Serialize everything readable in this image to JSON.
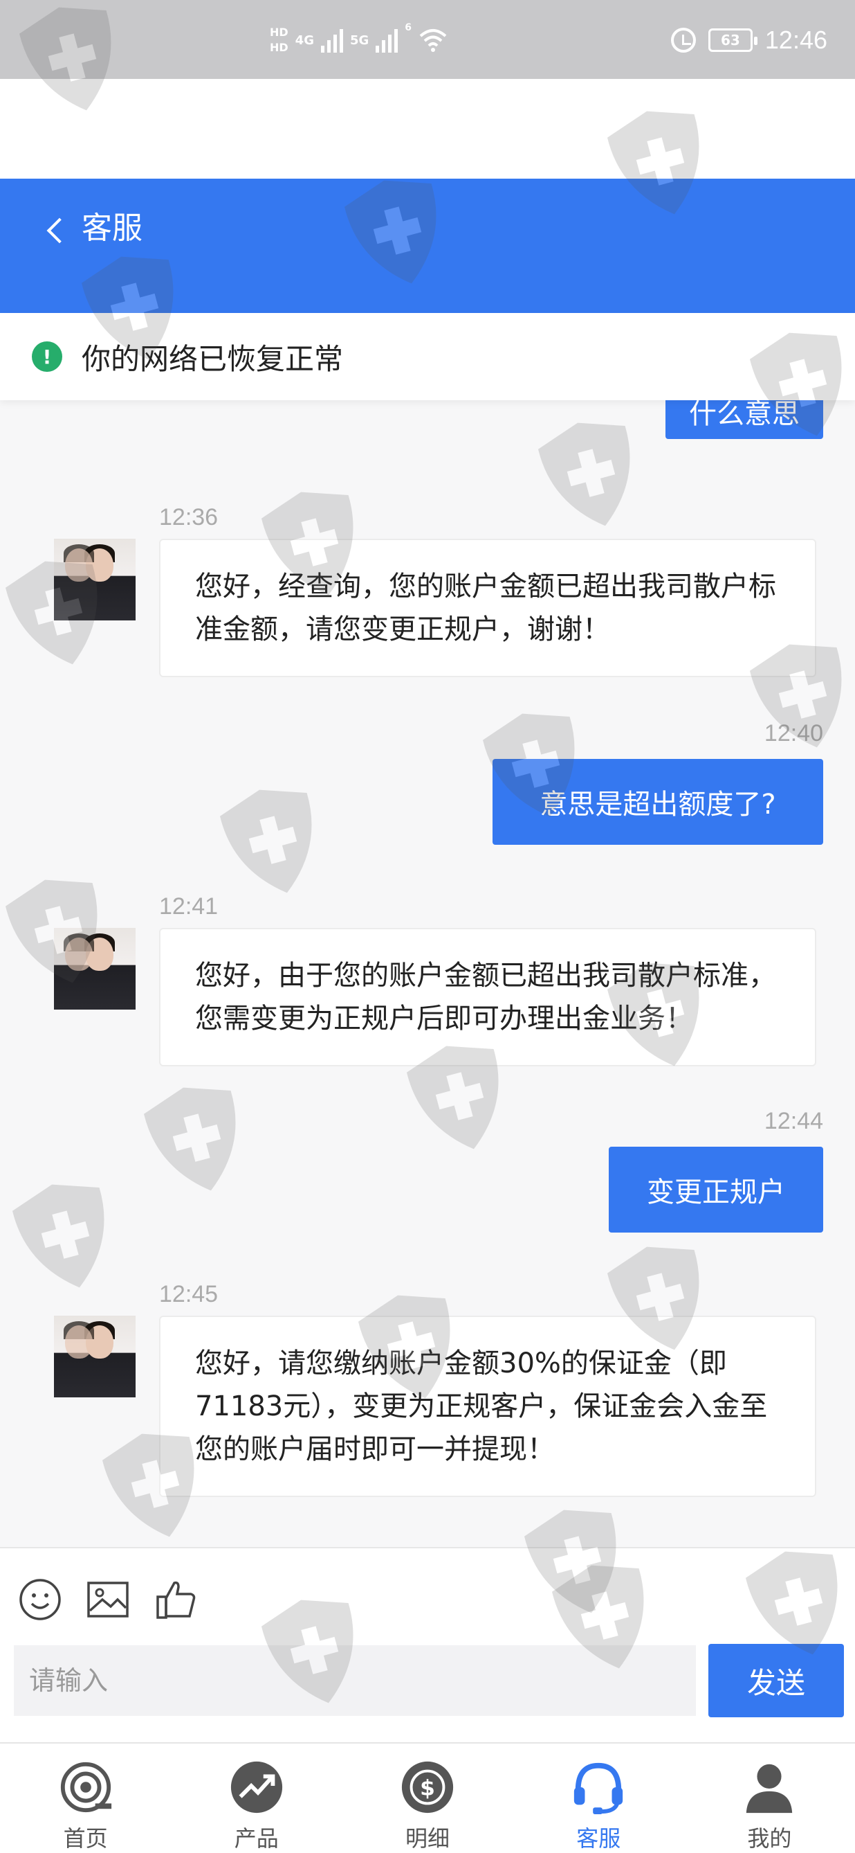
{
  "status_bar": {
    "hd1": "HD",
    "hd2": "HD",
    "net1": "4G",
    "net2": "5G",
    "wifi_badge": "6",
    "battery": "63",
    "time": "12:46"
  },
  "header": {
    "title": "客服"
  },
  "notice": {
    "icon": "!",
    "text": "你的网络已恢复正常"
  },
  "messages": [
    {
      "side": "right",
      "text": "什么意思"
    },
    {
      "side": "left",
      "time": "12:36",
      "text": "您好，经查询，您的账户金额已超出我司散户标准金额，请您变更正规户，谢谢！"
    },
    {
      "side": "right",
      "time": "12:40",
      "text": "意思是超出额度了?"
    },
    {
      "side": "left",
      "time": "12:41",
      "text": "您好，由于您的账户金额已超出我司散户标准，您需变更为正规户后即可办理出金业务！"
    },
    {
      "side": "right",
      "time": "12:44",
      "text": "变更正规户"
    },
    {
      "side": "left",
      "time": "12:45",
      "text": "您好，请您缴纳账户金额30%的保证金（即71183元），变更为正规客户，保证金会入金至您的账户届时即可一并提现！"
    }
  ],
  "composer": {
    "placeholder": "请输入",
    "send_label": "发送",
    "icons": [
      "emoji-icon",
      "image-icon",
      "thumbs-up-icon"
    ]
  },
  "nav": {
    "items": [
      {
        "label": "首页",
        "icon": "home-icon"
      },
      {
        "label": "产品",
        "icon": "trend-icon"
      },
      {
        "label": "明细",
        "icon": "dollar-icon"
      },
      {
        "label": "客服",
        "icon": "headset-icon"
      },
      {
        "label": "我的",
        "icon": "user-icon"
      }
    ],
    "active": "客服"
  },
  "colors": {
    "primary": "#3578f0",
    "status_bar": "#c8c8ca",
    "success": "#26ad6b"
  }
}
